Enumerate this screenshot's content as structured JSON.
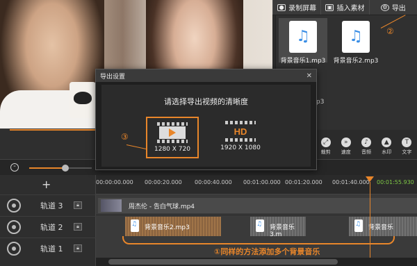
{
  "top_toolbar": {
    "record_label": "录制屏幕",
    "insert_label": "插入素材",
    "export_label": "导出"
  },
  "library": {
    "items": [
      {
        "name": "背景音乐1.mp3",
        "selected": true
      },
      {
        "name": "背景音乐2.mp3",
        "selected": false
      }
    ],
    "partial_label": "p3"
  },
  "edit_tools": [
    {
      "icon": "crop-icon",
      "label": "裁剪"
    },
    {
      "icon": "speed-icon",
      "label": "速度"
    },
    {
      "icon": "volume-icon",
      "label": "音频"
    },
    {
      "icon": "watermark-icon",
      "label": "水印"
    },
    {
      "icon": "text-icon",
      "label": "文字"
    }
  ],
  "ruler": {
    "ticks": [
      "00:00:00.000",
      "00:00:20.000",
      "00:00:40.000",
      "00:01:00.000",
      "00:01:20.000",
      "00:01:40.000"
    ],
    "current_time": "00:01:55.930"
  },
  "tracks": [
    {
      "label": "轨道 3"
    },
    {
      "label": "轨道 2"
    },
    {
      "label": "轨道 1"
    }
  ],
  "add_track_symbol": "+",
  "clips": {
    "video": "周杰伦 - 告白气球.mp4",
    "audio": [
      "背景音乐2.mp3",
      "背景音乐3.m",
      "背景音乐"
    ]
  },
  "annotations": {
    "step1": "①同样的方法添加多个背景音乐",
    "step2": "②",
    "step3": "③"
  },
  "dialog": {
    "title": "导出设置",
    "close_symbol": "✕",
    "prompt": "请选择导出视频的清晰度",
    "options": [
      {
        "label": "1280 X 720",
        "selected": true
      },
      {
        "label": "1920 X 1080",
        "selected": false
      }
    ],
    "hd_text": "HD"
  },
  "colors": {
    "accent": "#e9862a",
    "time_green": "#7ec845"
  }
}
